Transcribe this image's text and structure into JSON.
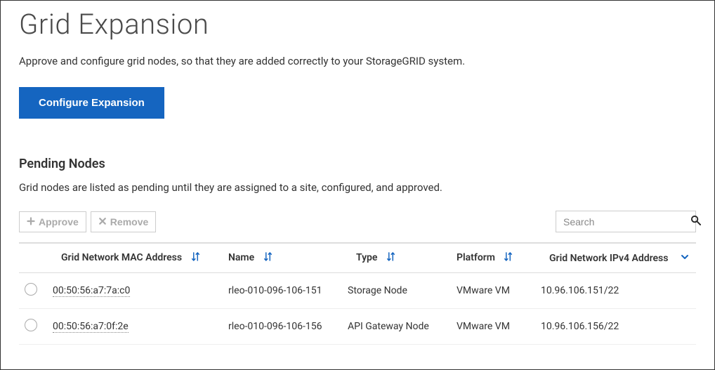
{
  "header": {
    "title": "Grid Expansion",
    "description": "Approve and configure grid nodes, so that they are added correctly to your StorageGRID system.",
    "configure_button": "Configure Expansion"
  },
  "pending": {
    "heading": "Pending Nodes",
    "description": "Grid nodes are listed as pending until they are assigned to a site, configured, and approved.",
    "approve_label": "Approve",
    "remove_label": "Remove",
    "search_placeholder": "Search",
    "columns": {
      "mac": "Grid Network MAC Address",
      "name": "Name",
      "type": "Type",
      "platform": "Platform",
      "ip": "Grid Network IPv4 Address"
    },
    "rows": [
      {
        "mac": "00:50:56:a7:7a:c0",
        "name": "rleo-010-096-106-151",
        "type": "Storage Node",
        "platform": "VMware VM",
        "ip": "10.96.106.151/22"
      },
      {
        "mac": "00:50:56:a7:0f:2e",
        "name": "rleo-010-096-106-156",
        "type": "API Gateway Node",
        "platform": "VMware VM",
        "ip": "10.96.106.156/22"
      }
    ]
  },
  "colors": {
    "primary": "#1565c0",
    "sort_icon": "#1565c0"
  }
}
